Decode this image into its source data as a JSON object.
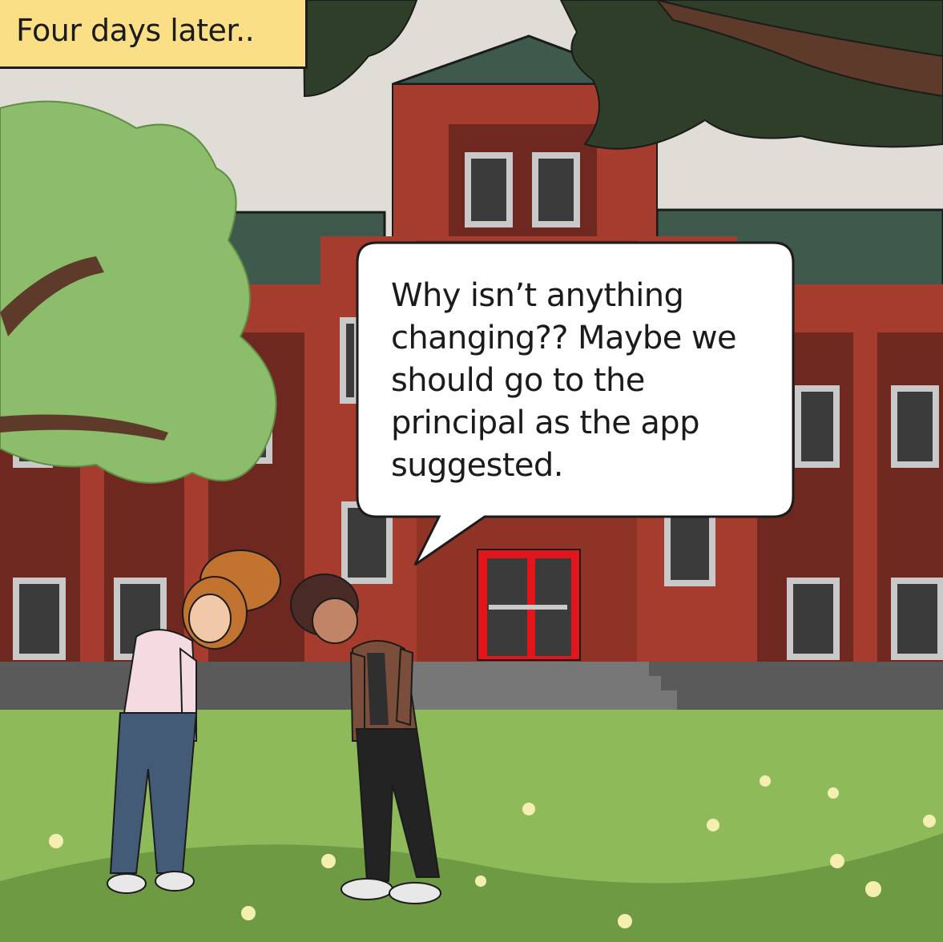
{
  "caption": {
    "text": "Four days later.."
  },
  "speech": {
    "text": "Why isn’t anything changing?? Maybe we should go to the principal as the app suggested."
  }
}
